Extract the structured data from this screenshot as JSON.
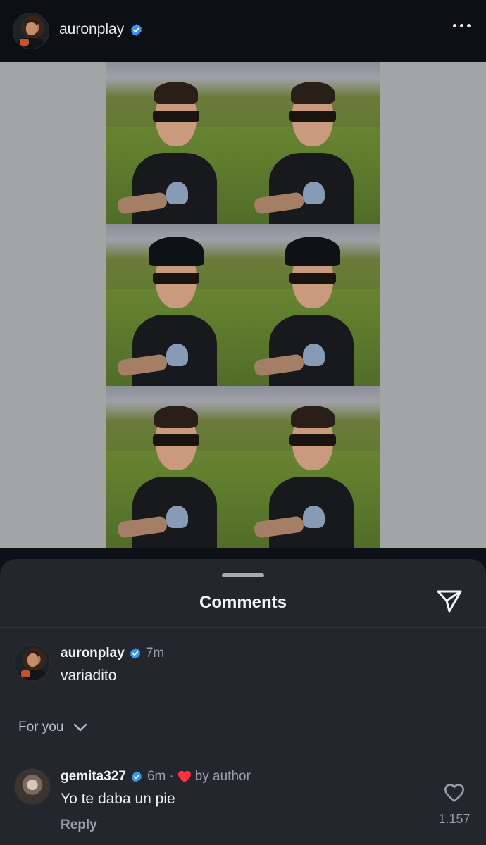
{
  "post": {
    "username": "auronplay",
    "verified": true,
    "more_icon": "more-horizontal-icon"
  },
  "sheet": {
    "title": "Comments",
    "share_icon": "send-icon"
  },
  "caption": {
    "username": "auronplay",
    "time": "7m",
    "text": "variadito"
  },
  "filter": {
    "label": "For you",
    "icon": "chevron-down-icon"
  },
  "comments": [
    {
      "username": "gemita327",
      "time": "6m",
      "separator": "·",
      "liked_by": "by author",
      "text": "Yo te daba un pie",
      "reply_label": "Reply",
      "like_count": "1.157"
    }
  ],
  "colors": {
    "verified_blue": "#3797f0",
    "heart_red": "#ff3040",
    "sheet_bg": "#23262d"
  }
}
